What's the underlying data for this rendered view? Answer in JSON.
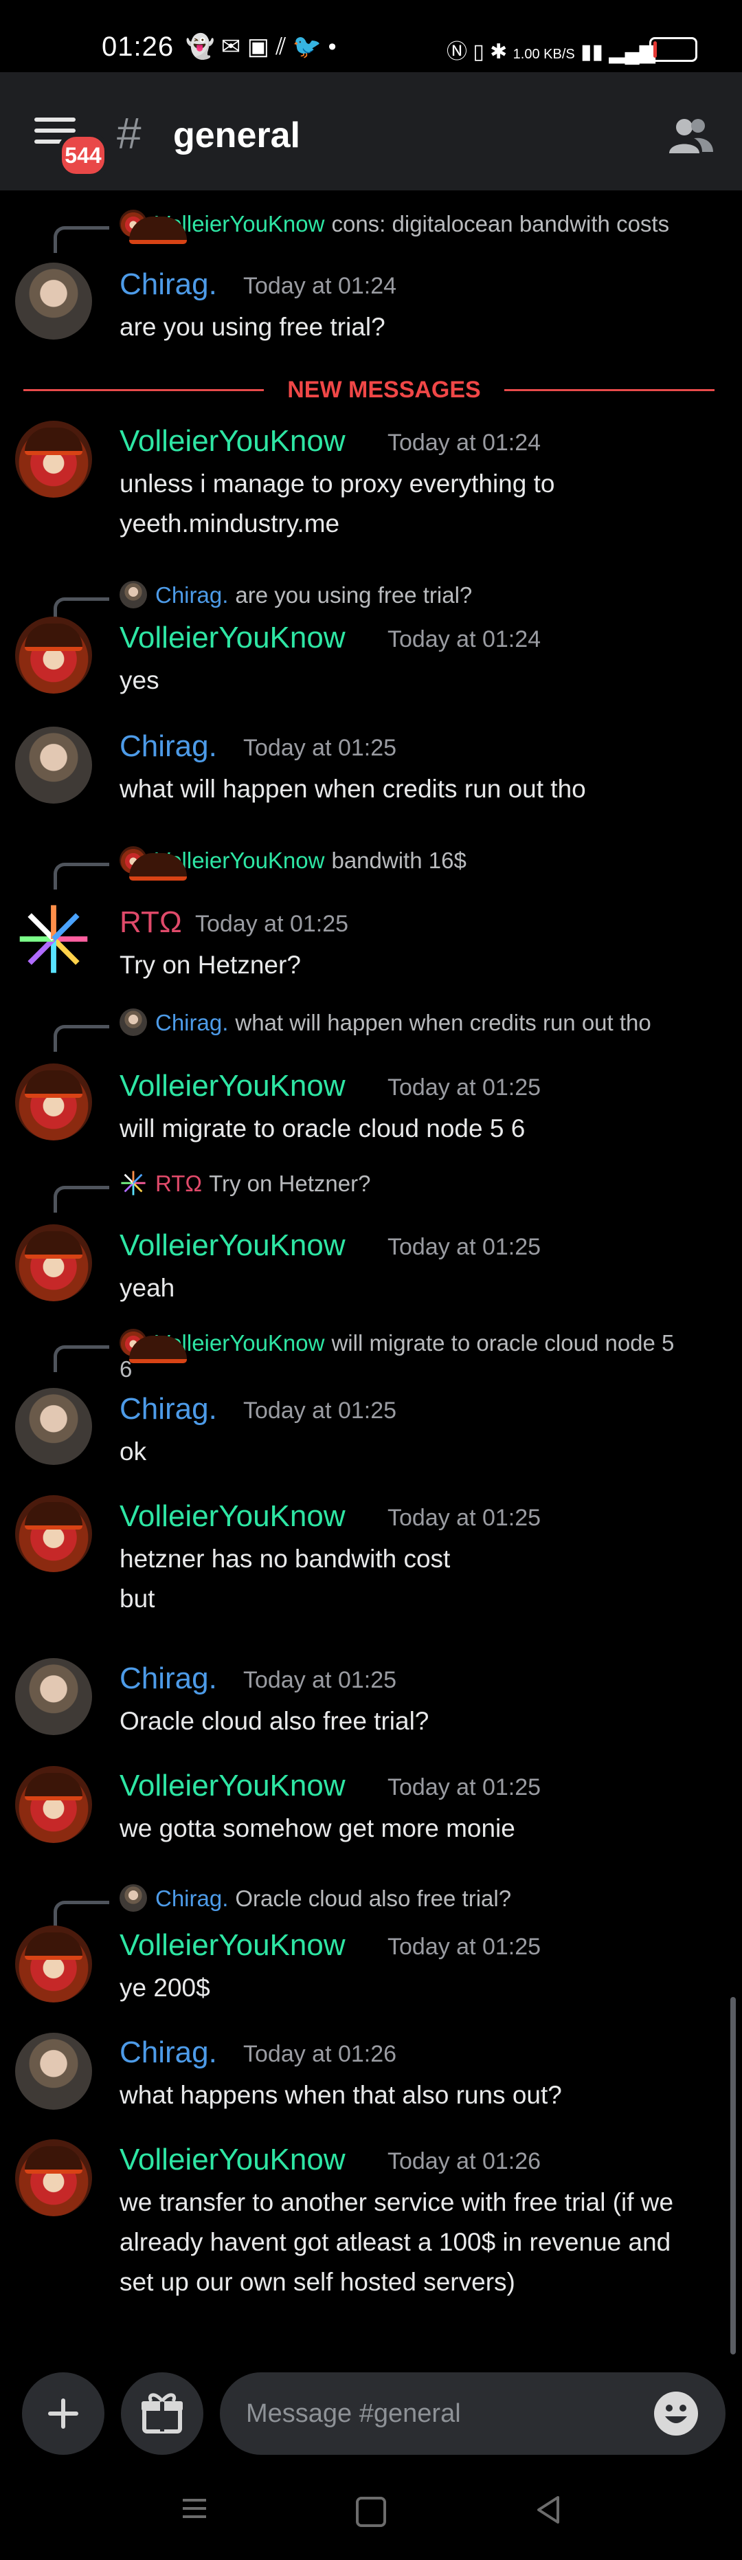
{
  "status_bar": {
    "time": "01:26",
    "net_speed": "1.00 KB/S",
    "battery": "8",
    "battery_level": 0.08,
    "battery_color": "#e53935"
  },
  "header": {
    "menu_icon": "hamburger-menu-icon",
    "badge_count": "544",
    "channel_hash": "#",
    "channel_name": "general",
    "members_icon": "members-icon"
  },
  "colors": {
    "VolleierYouKnow": "#2ee6a4",
    "Chirag.": "#4d9be8",
    "RTΩ": "#e04a6a",
    "new_messages": "#f04747"
  },
  "messages": [
    {
      "reply": {
        "user": "VolleierYouKnow",
        "text": "cons: digitalocean bandwith costs"
      },
      "user": "Chirag.",
      "ts": "Today at 01:24",
      "lines": [
        "are you using free trial?"
      ]
    },
    {
      "user": "VolleierYouKnow",
      "ts": "Today at 01:24",
      "lines": [
        "unless i manage to proxy everything to",
        "yeeth.mindustry.me"
      ]
    },
    {
      "reply": {
        "user": "Chirag.",
        "text": "are you using free trial?"
      },
      "user": "VolleierYouKnow",
      "ts": "Today at 01:24",
      "lines": [
        "yes"
      ]
    },
    {
      "user": "Chirag.",
      "ts": "Today at 01:25",
      "lines": [
        "what will happen when credits run out tho"
      ]
    },
    {
      "reply": {
        "user": "VolleierYouKnow",
        "text": "bandwith 16$"
      },
      "user": "RTΩ",
      "ts": "Today at 01:25",
      "lines": [
        "Try on Hetzner?"
      ]
    },
    {
      "reply": {
        "user": "Chirag.",
        "text": "what will happen when credits run out tho"
      },
      "user": "VolleierYouKnow",
      "ts": "Today at 01:25",
      "lines": [
        "will migrate to oracle cloud node 5 6"
      ]
    },
    {
      "reply": {
        "user": "RTΩ",
        "text": "Try on Hetzner?"
      },
      "user": "VolleierYouKnow",
      "ts": "Today at 01:25",
      "lines": [
        "yeah"
      ]
    },
    {
      "reply": {
        "user": "VolleierYouKnow",
        "text": "will migrate to oracle cloud node 5",
        "text2": "6"
      },
      "user": "Chirag.",
      "ts": "Today at 01:25",
      "lines": [
        "ok"
      ]
    },
    {
      "user": "VolleierYouKnow",
      "ts": "Today at 01:25",
      "lines": [
        "hetzner has no bandwith cost",
        "but"
      ]
    },
    {
      "user": "Chirag.",
      "ts": "Today at 01:25",
      "lines": [
        "Oracle cloud also free trial?"
      ]
    },
    {
      "user": "VolleierYouKnow",
      "ts": "Today at 01:25",
      "lines": [
        "we gotta somehow get more monie"
      ]
    },
    {
      "reply": {
        "user": "Chirag.",
        "text": "Oracle cloud also free trial?"
      },
      "user": "VolleierYouKnow",
      "ts": "Today at 01:25",
      "lines": [
        "ye 200$"
      ]
    },
    {
      "user": "Chirag.",
      "ts": "Today at 01:26",
      "lines": [
        "what happens when that also runs out?"
      ]
    },
    {
      "user": "VolleierYouKnow",
      "ts": "Today at 01:26",
      "lines": [
        "we transfer to another service with free trial (if we",
        "already havent got atleast a 100$ in revenue and",
        "set up our own self hosted servers)"
      ]
    }
  ],
  "divider": {
    "label": "NEW MESSAGES"
  },
  "composer": {
    "add_icon": "plus-icon",
    "gift_icon": "gift-icon",
    "placeholder": "Message #general",
    "emoji_icon": "emoji-icon"
  },
  "nav": {
    "menu": "recents-icon",
    "home": "home-icon",
    "back": "back-icon"
  }
}
